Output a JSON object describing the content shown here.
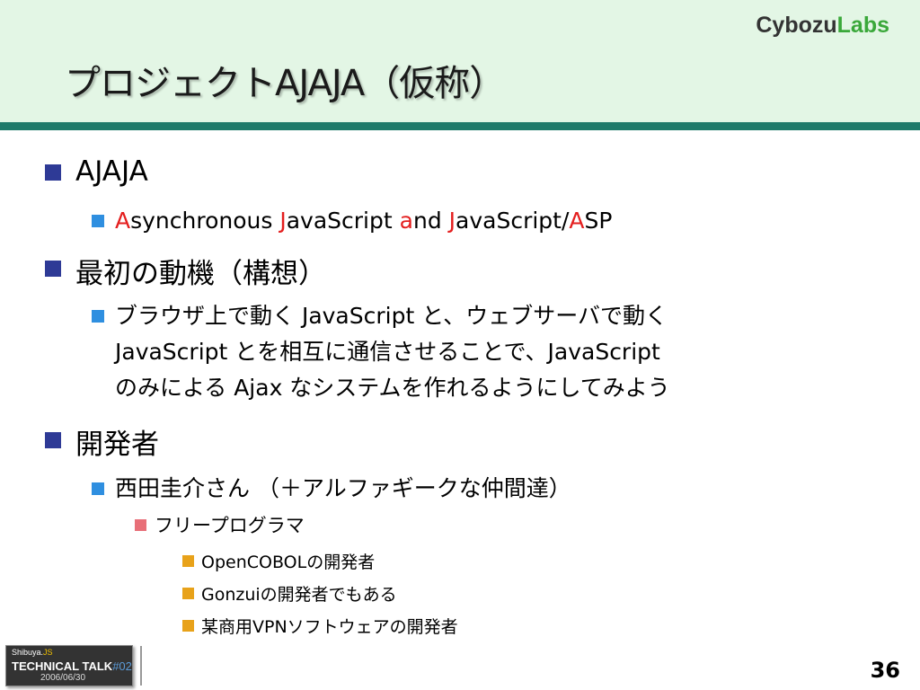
{
  "header": {
    "title": "プロジェクトAJAJA（仮称）",
    "logo_part1": "Cybozu",
    "logo_part2": "Labs"
  },
  "sections": {
    "s1": {
      "heading": "AJAJA",
      "sub": {
        "parts": [
          "A",
          "synchronous ",
          "J",
          "avaScript ",
          "a",
          "nd ",
          "J",
          "avaScript/",
          "A",
          "SP"
        ]
      }
    },
    "s2": {
      "heading": "最初の動機（構想）",
      "sub": {
        "line1": "ブラウザ上で動く JavaScript と、ウェブサーバで動く",
        "line2": "JavaScript とを相互に通信させることで、JavaScript",
        "line3": "のみによる Ajax なシステムを作れるようにしてみよう"
      }
    },
    "s3": {
      "heading": "開発者",
      "sub": "西田圭介さん （＋アルファギークな仲間達）",
      "subsub": "フリープログラマ",
      "items": [
        "OpenCOBOLの開発者",
        "Gonzuiの開発者でもある",
        "某商用VPNソフトウェアの開発者"
      ]
    }
  },
  "footer": {
    "badge_small_a": "Shibuya.",
    "badge_small_b": "JS",
    "badge_main": "TECHNICAL TALK",
    "badge_num": "#02",
    "badge_date": "2006/06/30",
    "page_number": "36"
  },
  "colors": {
    "header_bg": "#e3f6e5",
    "header_bar": "#1f7a6a",
    "accent_red": "#e41e1e",
    "bullet_level1": "#2e3a96",
    "bullet_level2": "#2f8fe0",
    "bullet_level3": "#e86f78",
    "bullet_level4": "#e8a21a"
  }
}
